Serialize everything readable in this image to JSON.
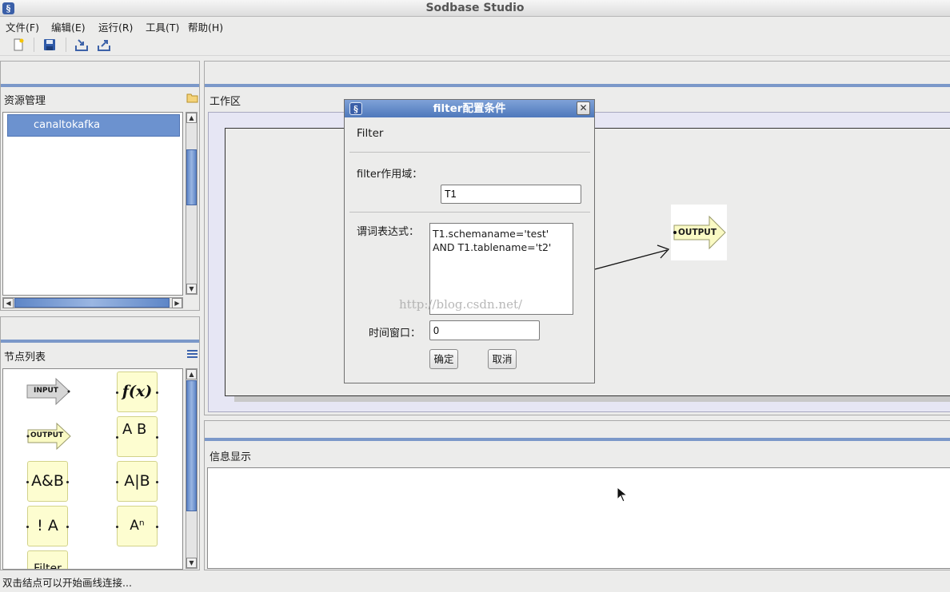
{
  "window": {
    "title": "Sodbase Studio",
    "icon": "sodbase-logo-icon"
  },
  "menubar": [
    "文件(F)",
    "编辑(E)",
    "运行(R)",
    "工具(T)",
    "帮助(H)"
  ],
  "toolbar": [
    "new-file-icon",
    "save-icon",
    "import-icon",
    "export-icon"
  ],
  "resources": {
    "title": "资源管理",
    "items": [
      "canaltokafka"
    ],
    "selected_index": 0
  },
  "nodes": {
    "title": "节点列表",
    "items": [
      "INPUT",
      "f(x)",
      "OUTPUT",
      "A B",
      "A&B",
      "A|B",
      "! A",
      "Aⁿ",
      "Filter"
    ]
  },
  "workspace": {
    "title": "工作区",
    "output_node": "OUTPUT"
  },
  "info": {
    "title": "信息显示"
  },
  "dialog": {
    "title": "filter配置条件",
    "header": "Filter",
    "scope_label": "filter作用域：",
    "scope_value": "T1",
    "predicate_label": "谓词表达式：",
    "predicate_lines": [
      "T1.schemaname='test'",
      "AND T1.tablename='t2'"
    ],
    "watermark": "http://blog.csdn.net/",
    "window_label": "时间窗口：",
    "window_value": "0",
    "ok": "确定",
    "cancel": "取消"
  },
  "status": "双击结点可以开始画线连接..."
}
